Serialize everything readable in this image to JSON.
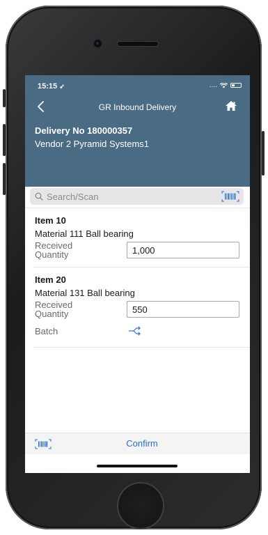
{
  "status_bar": {
    "time": "15:15",
    "signal": "...."
  },
  "nav": {
    "title": "GR Inbound Delivery",
    "back_icon": "chevron-left-icon",
    "home_icon": "home-icon"
  },
  "header": {
    "delivery_no": "Delivery No 180000357",
    "vendor": "Vendor 2 Pyramid Systems1"
  },
  "search": {
    "placeholder": "Search/Scan",
    "scan_icon": "barcode-icon"
  },
  "items": [
    {
      "title": "Item 10",
      "material": "Material 111 Ball bearing",
      "received_label_line1": "Received",
      "received_label_line2": "Quantity",
      "received_quantity": "1,000"
    },
    {
      "title": "Item 20",
      "material": "Material 131 Ball bearing",
      "received_label_line1": "Received",
      "received_label_line2": "Quantity",
      "received_quantity": "550",
      "batch_label": "Batch",
      "batch_icon": "split-icon"
    }
  ],
  "footer": {
    "confirm_label": "Confirm",
    "scan_icon": "barcode-icon"
  },
  "colors": {
    "header_bg": "#4a6b84",
    "accent": "#2a6fc9"
  }
}
